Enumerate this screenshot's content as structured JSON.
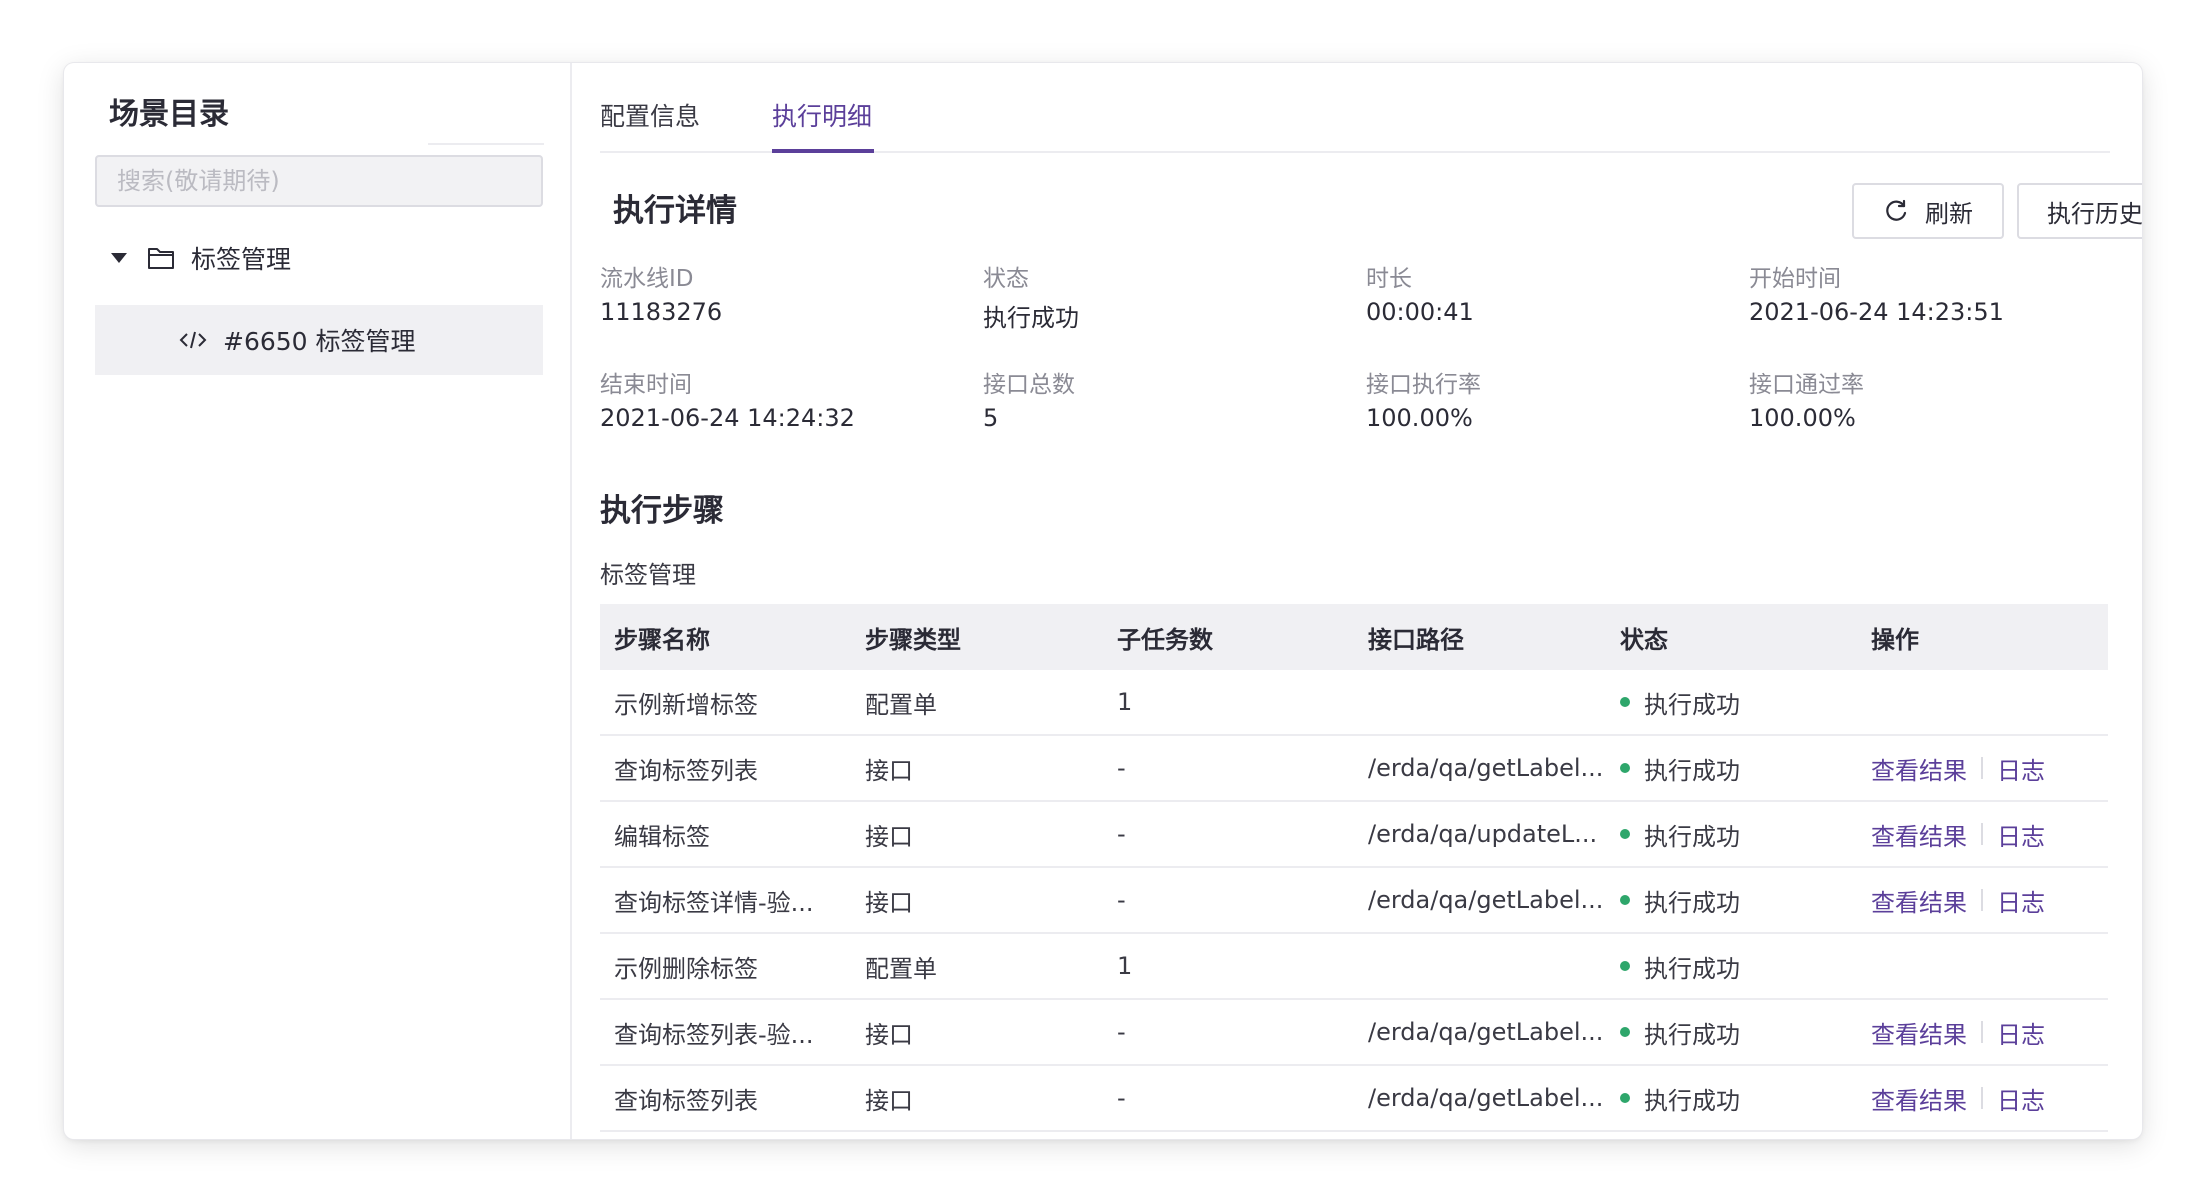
{
  "sidebar": {
    "title": "场景目录",
    "search_placeholder": "搜索(敬请期待)",
    "folder_label": "标签管理",
    "leaf_label": "#6650 标签管理"
  },
  "tabs": [
    {
      "label": "配置信息",
      "active": false
    },
    {
      "label": "执行明细",
      "active": true
    }
  ],
  "details": {
    "title": "执行详情",
    "refresh_label": "刷新",
    "history_label": "执行历史",
    "fields": [
      {
        "label": "流水线ID",
        "value": "11183276"
      },
      {
        "label": "状态",
        "value": "执行成功"
      },
      {
        "label": "时长",
        "value": "00:00:41"
      },
      {
        "label": "开始时间",
        "value": "2021-06-24 14:23:51"
      },
      {
        "label": "结束时间",
        "value": "2021-06-24 14:24:32"
      },
      {
        "label": "接口总数",
        "value": "5"
      },
      {
        "label": "接口执行率",
        "value": "100.00%"
      },
      {
        "label": "接口通过率",
        "value": "100.00%"
      }
    ]
  },
  "steps": {
    "title": "执行步骤",
    "group_label": "标签管理",
    "columns": [
      "步骤名称",
      "步骤类型",
      "子任务数",
      "接口路径",
      "状态",
      "操作"
    ],
    "rows": [
      {
        "name": "示例新增标签",
        "type": "配置单",
        "subtasks": "1",
        "path": "",
        "status": "执行成功",
        "view": "",
        "log": ""
      },
      {
        "name": "查询标签列表",
        "type": "接口",
        "subtasks": "-",
        "path": "/erda/qa/getLabel...",
        "status": "执行成功",
        "view": "查看结果",
        "log": "日志"
      },
      {
        "name": "编辑标签",
        "type": "接口",
        "subtasks": "-",
        "path": "/erda/qa/updateL...",
        "status": "执行成功",
        "view": "查看结果",
        "log": "日志"
      },
      {
        "name": "查询标签详情-验...",
        "type": "接口",
        "subtasks": "-",
        "path": "/erda/qa/getLabel...",
        "status": "执行成功",
        "view": "查看结果",
        "log": "日志"
      },
      {
        "name": "示例删除标签",
        "type": "配置单",
        "subtasks": "1",
        "path": "",
        "status": "执行成功",
        "view": "",
        "log": ""
      },
      {
        "name": "查询标签列表-验...",
        "type": "接口",
        "subtasks": "-",
        "path": "/erda/qa/getLabel...",
        "status": "执行成功",
        "view": "查看结果",
        "log": "日志"
      },
      {
        "name": "查询标签列表",
        "type": "接口",
        "subtasks": "-",
        "path": "/erda/qa/getLabel...",
        "status": "执行成功",
        "view": "查看结果",
        "log": "日志"
      }
    ]
  },
  "colors": {
    "accent": "#5b3f9a",
    "success": "#2ea66b"
  }
}
